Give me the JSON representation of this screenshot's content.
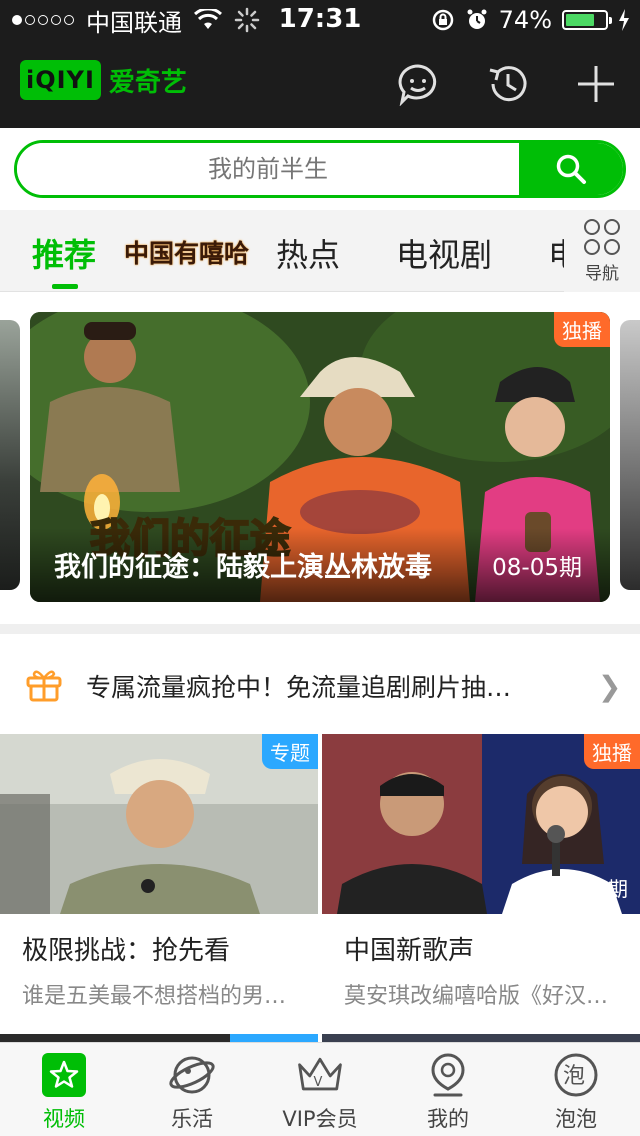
{
  "status_bar": {
    "carrier": "中国联通",
    "time": "17:31",
    "battery": "74%",
    "battery_level": 0.74,
    "signal_dots": 1
  },
  "header": {
    "logo_mark": "iQIYI",
    "logo_text": "爱奇艺",
    "icons": [
      "chat-bubble-icon",
      "history-clock-icon",
      "plus-icon"
    ]
  },
  "search": {
    "placeholder": "我的前半生",
    "button_icon": "search-icon"
  },
  "tabs": {
    "items": [
      "推荐",
      "中国有嘻哈",
      "热点",
      "电视剧",
      "电"
    ],
    "active_index": 0,
    "nav_label": "导航"
  },
  "banner": {
    "title": "我们的征途：陆毅上演丛林放毒",
    "date": "08-05期",
    "badge": "独播",
    "logo_text": "我们的征途"
  },
  "promo": {
    "text": "专属流量疯抢中！免流量追剧刷片抽…",
    "icon": "gift-icon"
  },
  "cards": [
    {
      "title": "极限挑战：抢先看",
      "subtitle": "谁是五美最不想搭档的男…",
      "badge": "专题",
      "date": ""
    },
    {
      "title": "中国新歌声",
      "subtitle": "莫安琪改编嘻哈版《好汉…",
      "badge": "独播",
      "date": "08-04期"
    }
  ],
  "tabbar": {
    "items": [
      {
        "label": "视频",
        "icon": "star-video-icon"
      },
      {
        "label": "乐活",
        "icon": "planet-icon"
      },
      {
        "label": "VIP会员",
        "icon": "crown-icon"
      },
      {
        "label": "我的",
        "icon": "user-icon"
      },
      {
        "label": "泡泡",
        "icon": "bubble-pao-icon"
      }
    ],
    "active_index": 0,
    "pao_glyph": "泡"
  },
  "colors": {
    "brand": "#00be06",
    "badge_orange": "#ff6a2a",
    "badge_blue": "#2ba8ff",
    "header_bg": "#1c1c1c"
  }
}
